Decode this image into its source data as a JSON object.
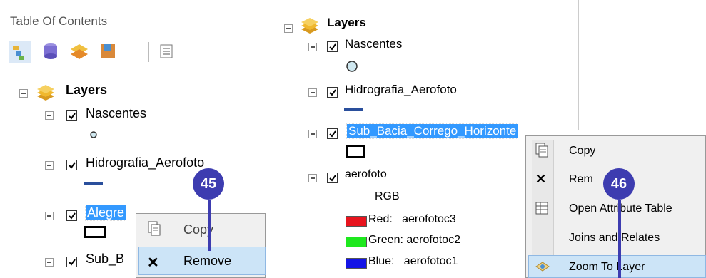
{
  "left": {
    "title": "Table Of Contents",
    "tree": {
      "root_label": "Layers",
      "nascentes": "Nascentes",
      "hidrografia": "Hidrografia_Aerofoto",
      "alegre": "Alegre",
      "sub_b": "Sub_B"
    },
    "menu": {
      "copy": "Copy",
      "remove": "Remove"
    },
    "callout": "45"
  },
  "right": {
    "tree": {
      "root_label": "Layers",
      "nascentes": "Nascentes",
      "hidrografia": "Hidrografia_Aerofoto",
      "sub_bacia": "Sub_Bacia_Corrego_Horizonte",
      "aerofoto": "aerofoto",
      "rgb": "RGB",
      "red": "Red:   aerofotoc3",
      "green": "Green: aerofotoc2",
      "blue": "Blue:   aerofotoc1"
    },
    "menu": {
      "copy": "Copy",
      "remove": "Rem",
      "open_attr": "Open Attribute Table",
      "joins": "Joins and Relates",
      "zoom": "Zoom To Layer"
    },
    "callout": "46"
  },
  "colors": {
    "selection": "#3399ff",
    "callout": "#3d3cb0",
    "red": "#e8141e",
    "green": "#1ee81e",
    "blue": "#1414e6"
  }
}
